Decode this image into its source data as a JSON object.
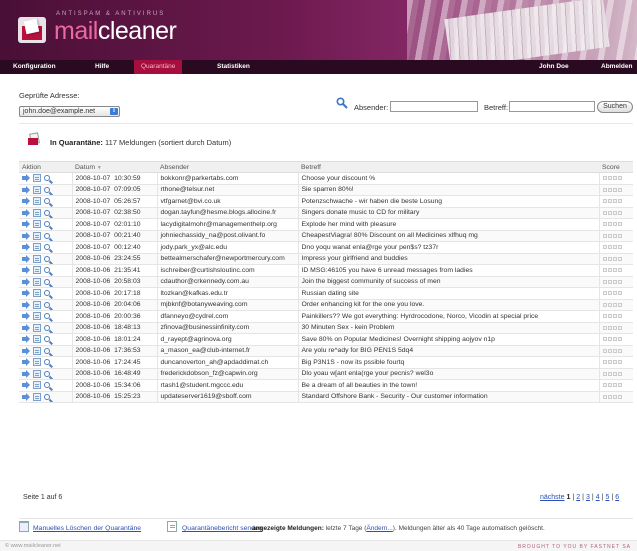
{
  "header": {
    "tagline": "ANTISPAM & ANTIVIRUS",
    "brand_mail": "mail",
    "brand_cleaner": "cleaner"
  },
  "nav": {
    "items": [
      "Konfiguration",
      "Hilfe",
      "Quarantäne",
      "Statistiken"
    ],
    "user": "John Doe",
    "logout": "Abmelden"
  },
  "filter": {
    "address_label": "Geprüfte Adresse:",
    "address_value": "john.doe@example.net",
    "sender_label": "Absender:",
    "subject_label": "Betreff:",
    "search_button": "Suchen"
  },
  "quarantine": {
    "title_bold": "In Quarantäne:",
    "title_rest": " 117 Meldungen (sortiert durch Datum)"
  },
  "table": {
    "headers": [
      "Aktion",
      "Datum",
      "Absender",
      "Betreff",
      "Score"
    ],
    "sort_indicator": "▼",
    "rows": [
      {
        "date": "2008-10-07",
        "time": "10:30:59",
        "sender": "bokkonr@parkertabs.com",
        "subject": "Choose your discount %"
      },
      {
        "date": "2008-10-07",
        "time": "07:09:05",
        "sender": "rthone@telsur.net",
        "subject": "Sie sparren 80%!"
      },
      {
        "date": "2008-10-07",
        "time": "05:26:57",
        "sender": "vtfgarnet@bvi.co.uk",
        "subject": "Potenzschwache - wir haben die beste Losung"
      },
      {
        "date": "2008-10-07",
        "time": "02:38:50",
        "sender": "dogan.tayfun@hesme.blogs.allocine.fr",
        "subject": "Singers donate music to CD for military"
      },
      {
        "date": "2008-10-07",
        "time": "02:01:10",
        "sender": "lacydigitalmohr@managementhelp.org",
        "subject": "Explode her mind with pleasure"
      },
      {
        "date": "2008-10-07",
        "time": "00:21:40",
        "sender": "johniechassidy_na@post.olivant.fo",
        "subject": "CheapestViagra! 80% Discount on all Medicines xlfhuq mg"
      },
      {
        "date": "2008-10-07",
        "time": "00:12:40",
        "sender": "jody.park_yx@alc.edu",
        "subject": "Dno yoqu wanat enla@rge your pen$s? tz37r"
      },
      {
        "date": "2008-10-06",
        "time": "23:24:55",
        "sender": "bettealmerschafer@newportmercury.com",
        "subject": "Impress your girlfriend and buddies"
      },
      {
        "date": "2008-10-06",
        "time": "21:35:41",
        "sender": "ischreiber@curtishsloutinc.com",
        "subject": "ID MSG:46105 you have 6 unread messages from ladies"
      },
      {
        "date": "2008-10-06",
        "time": "20:58:03",
        "sender": "cdauthor@crkennedy.com.au",
        "subject": "Join the biggest community of success of men"
      },
      {
        "date": "2008-10-06",
        "time": "20:17:18",
        "sender": "ltozkan@kafkas.edu.tr",
        "subject": "Russian dating site"
      },
      {
        "date": "2008-10-06",
        "time": "20:04:06",
        "sender": "mjbknf@botanyweaving.com",
        "subject": "Order enhancing kit for the one you love."
      },
      {
        "date": "2008-10-06",
        "time": "20:00:36",
        "sender": "dfanneyo@cydrel.com",
        "subject": "Painkillers?? We got everything: Hyrdrocodone, Norco, Vicodin at special price"
      },
      {
        "date": "2008-10-06",
        "time": "18:48:13",
        "sender": "zfinova@businessinfinity.com",
        "subject": "30 Minuten Sex - kein Problem"
      },
      {
        "date": "2008-10-06",
        "time": "18:01:24",
        "sender": "d_rayept@agrinova.org",
        "subject": "Save 80% on Popular Medicines! Overnight shipping aojyov n1p"
      },
      {
        "date": "2008-10-06",
        "time": "17:36:53",
        "sender": "a_mason_ea@club-internet.fr",
        "subject": "Are yolu re^ady for BIG PEN1S 5dq4"
      },
      {
        "date": "2008-10-06",
        "time": "17:24:45",
        "sender": "duncanoverton_ah@apdaddimat.ch",
        "subject": "Big P3N1S - now its pssible fourtq"
      },
      {
        "date": "2008-10-06",
        "time": "16:48:49",
        "sender": "frederickdobson_fz@capwin.org",
        "subject": "Dlo yoau w[ant enla(rge your pecnis? wel3o"
      },
      {
        "date": "2008-10-06",
        "time": "15:34:06",
        "sender": "rtash1@student.mgccc.edu",
        "subject": "Be a dream of all beauties in the town!"
      },
      {
        "date": "2008-10-06",
        "time": "15:25:23",
        "sender": "updateserver1619@sboff.com",
        "subject": "Standard Offshore Bank - Security - Our customer information"
      }
    ]
  },
  "pager": {
    "page_info": "Seite 1 auf 6",
    "next_label": "nächste",
    "pages": [
      "1",
      "2",
      "3",
      "4",
      "5",
      "6"
    ]
  },
  "bottom": {
    "purge_link": "Manuelles Löschen der Quarantäne",
    "report_link": "Quarantänebericht senden",
    "info_bold": "angezeigte Meldungen:",
    "info_text1": " letzte 7 Tage (",
    "info_link": "Ändern...",
    "info_text2": "). Meldungen älter als 40 Tage automatisch gelöscht."
  },
  "footer": {
    "url": "© www.mailcleaner.net",
    "credit": "BROUGHT TO YOU BY FASTNET SA"
  }
}
